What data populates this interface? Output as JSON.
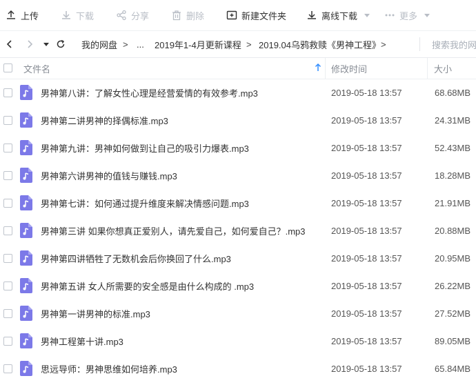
{
  "toolbar": {
    "upload": "上传",
    "download": "下载",
    "share": "分享",
    "delete": "删除",
    "new_folder": "新建文件夹",
    "offline_download": "离线下载",
    "more": "更多"
  },
  "address": {
    "crumbs": [
      "我的网盘",
      "...",
      "2019年1-4月更新课程",
      "2019.04乌鸦救赎《男神工程》"
    ],
    "separator": ">",
    "search_placeholder": "搜索我的网盘"
  },
  "table": {
    "headers": {
      "name": "文件名",
      "modified": "修改时间",
      "size": "大小"
    },
    "rows": [
      {
        "name": "男神第八讲：了解女性心理是经营爱情的有效参考.mp3",
        "modified": "2019-05-18 13:57",
        "size": "68.68MB"
      },
      {
        "name": "男神第二讲男神的择偶标准.mp3",
        "modified": "2019-05-18 13:57",
        "size": "24.31MB"
      },
      {
        "name": "男神第九讲：男神如何做到让自己的吸引力爆表.mp3",
        "modified": "2019-05-18 13:57",
        "size": "52.43MB"
      },
      {
        "name": "男神第六讲男神的值钱与赚钱.mp3",
        "modified": "2019-05-18 13:57",
        "size": "18.28MB"
      },
      {
        "name": "男神第七讲：如何通过提升维度来解决情感问题.mp3",
        "modified": "2019-05-18 13:57",
        "size": "21.91MB"
      },
      {
        "name": "男神第三讲 如果你想真正爱别人，请先爱自己，如何爱自己？.mp3",
        "modified": "2019-05-18 13:57",
        "size": "20.88MB"
      },
      {
        "name": "男神第四讲牺牲了无数机会后你换回了什么.mp3",
        "modified": "2019-05-18 13:57",
        "size": "20.95MB"
      },
      {
        "name": "男神第五讲 女人所需要的安全感是由什么构成的 .mp3",
        "modified": "2019-05-18 13:57",
        "size": "26.22MB"
      },
      {
        "name": "男神第一讲男神的标准.mp3",
        "modified": "2019-05-18 13:57",
        "size": "27.52MB"
      },
      {
        "name": "男神工程第十讲.mp3",
        "modified": "2019-05-18 13:57",
        "size": "89.05MB"
      },
      {
        "name": "思远导师：男神思维如何培养.mp3",
        "modified": "2019-05-18 13:57",
        "size": "65.84MB"
      }
    ]
  },
  "colors": {
    "accent": "#2f8cff",
    "file_icon": "#7c79e8",
    "disabled": "#b9bec6"
  }
}
